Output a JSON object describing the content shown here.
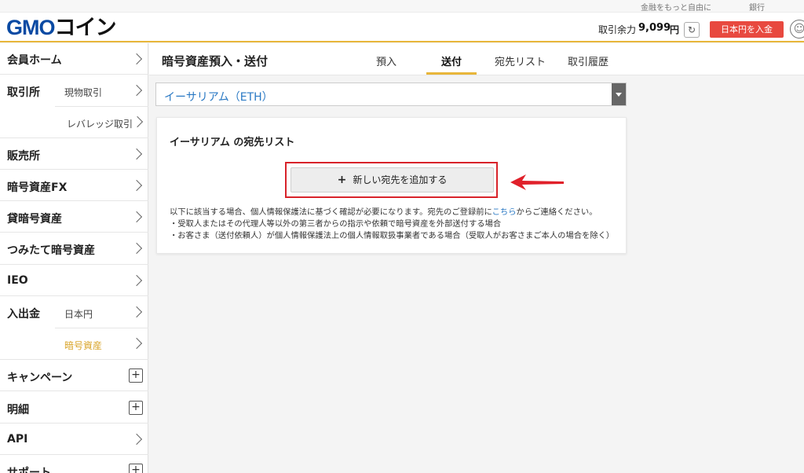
{
  "top_links": [
    "金融をもっと自由に",
    "銀行"
  ],
  "logo": {
    "gmo": "GMO",
    "kana": "コイン"
  },
  "header": {
    "balance_label": "取引余力",
    "balance_value": "9,099",
    "balance_unit": "円",
    "deposit_button": "日本円を入金"
  },
  "sidebar": {
    "home": "会員ホーム",
    "trade": "取引所",
    "trade_spot": "現物取引",
    "trade_leverage": "レバレッジ取引",
    "sales": "販売所",
    "fx": "暗号資産FX",
    "lending": "貸暗号資産",
    "tsumitate": "つみたて暗号資産",
    "ieo": "IEO",
    "inout": "入出金",
    "inout_jpy": "日本円",
    "inout_crypto": "暗号資産",
    "campaign": "キャンペーン",
    "statement": "明細",
    "api": "API",
    "support": "サポート"
  },
  "page": {
    "title": "暗号資産預入・送付",
    "tabs": [
      "預入",
      "送付",
      "宛先リスト",
      "取引履歴"
    ],
    "active_tab": "送付"
  },
  "coin_select": {
    "selected": "イーサリアム（ETH）"
  },
  "card": {
    "title": "イーサリアム の宛先リスト",
    "add_button": "新しい宛先を追加する",
    "note_line1_pre": "以下に該当する場合、個人情報保護法に基づく確認が必要になります。宛先のご登録前に",
    "note_link": "こちら",
    "note_line1_post": "からご連絡ください。",
    "note_line2": "・受取人またはその代理人等以外の第三者からの指示や依頼で暗号資産を外部送付する場合",
    "note_line3": "・お客さま（送付依頼人）が個人情報保護法上の個人情報取扱事業者である場合（受取人がお客さまご本人の場合を除く）"
  },
  "colors": {
    "brand_blue": "#0a4aa3",
    "accent_gold": "#e8b63a",
    "deposit_red": "#e8493f",
    "highlight_red": "#d8232a",
    "link_blue": "#2a79c4"
  },
  "icons": [
    "refresh-icon",
    "user-icon",
    "chevron-right-icon",
    "plus-box-icon",
    "plus-icon",
    "caret-down-icon",
    "red-arrow-icon"
  ]
}
